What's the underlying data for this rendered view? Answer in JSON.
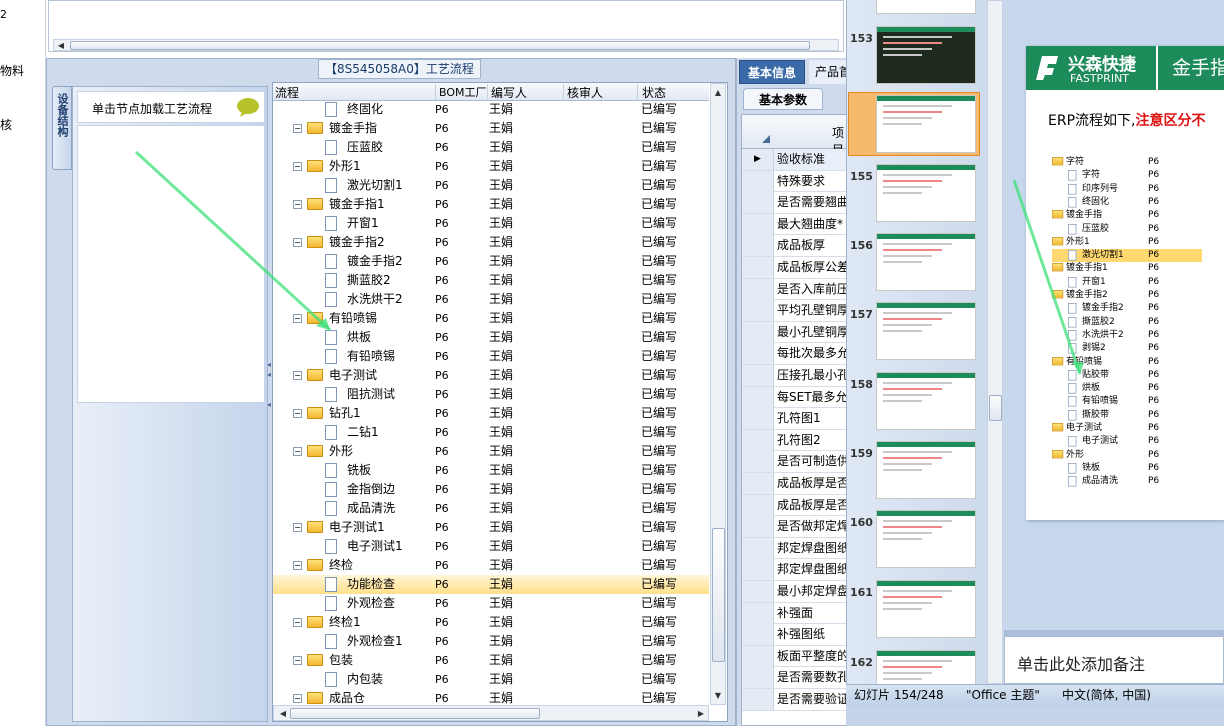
{
  "left_edge": {
    "labels": [
      "2",
      "物料",
      "核"
    ]
  },
  "process_panel": {
    "title": "【8S545058A0】工艺流程",
    "vertical_tab": "设备结构",
    "hint": "单击节点加载工艺流程",
    "columns": [
      "流程",
      "BOM工厂",
      "编写人",
      "核审人",
      "状态"
    ],
    "rows": [
      {
        "label": "终固化",
        "level": 2,
        "folder": false,
        "bom": "P6",
        "writer": "王娟",
        "reviewer": "",
        "status": "已编写"
      },
      {
        "label": "镀金手指",
        "level": 1,
        "folder": true,
        "bom": "P6",
        "writer": "王娟",
        "reviewer": "",
        "status": "已编写"
      },
      {
        "label": "压蓝胶",
        "level": 2,
        "folder": false,
        "bom": "P6",
        "writer": "王娟",
        "reviewer": "",
        "status": "已编写"
      },
      {
        "label": "外形1",
        "level": 1,
        "folder": true,
        "bom": "P6",
        "writer": "王娟",
        "reviewer": "",
        "status": "已编写"
      },
      {
        "label": "激光切割1",
        "level": 2,
        "folder": false,
        "bom": "P6",
        "writer": "王娟",
        "reviewer": "",
        "status": "已编写"
      },
      {
        "label": "镀金手指1",
        "level": 1,
        "folder": true,
        "bom": "P6",
        "writer": "王娟",
        "reviewer": "",
        "status": "已编写"
      },
      {
        "label": "开窗1",
        "level": 2,
        "folder": false,
        "bom": "P6",
        "writer": "王娟",
        "reviewer": "",
        "status": "已编写"
      },
      {
        "label": "镀金手指2",
        "level": 1,
        "folder": true,
        "bom": "P6",
        "writer": "王娟",
        "reviewer": "",
        "status": "已编写"
      },
      {
        "label": "镀金手指2",
        "level": 2,
        "folder": false,
        "bom": "P6",
        "writer": "王娟",
        "reviewer": "",
        "status": "已编写"
      },
      {
        "label": "撕蓝胶2",
        "level": 2,
        "folder": false,
        "bom": "P6",
        "writer": "王娟",
        "reviewer": "",
        "status": "已编写"
      },
      {
        "label": "水洗烘干2",
        "level": 2,
        "folder": false,
        "bom": "P6",
        "writer": "王娟",
        "reviewer": "",
        "status": "已编写"
      },
      {
        "label": "有铅喷锡",
        "level": 1,
        "folder": true,
        "bom": "P6",
        "writer": "王娟",
        "reviewer": "",
        "status": "已编写"
      },
      {
        "label": "烘板",
        "level": 2,
        "folder": false,
        "bom": "P6",
        "writer": "王娟",
        "reviewer": "",
        "status": "已编写"
      },
      {
        "label": "有铅喷锡",
        "level": 2,
        "folder": false,
        "bom": "P6",
        "writer": "王娟",
        "reviewer": "",
        "status": "已编写"
      },
      {
        "label": "电子测试",
        "level": 1,
        "folder": true,
        "bom": "P6",
        "writer": "王娟",
        "reviewer": "",
        "status": "已编写"
      },
      {
        "label": "阻抗测试",
        "level": 2,
        "folder": false,
        "bom": "P6",
        "writer": "王娟",
        "reviewer": "",
        "status": "已编写"
      },
      {
        "label": "钻孔1",
        "level": 1,
        "folder": true,
        "bom": "P6",
        "writer": "王娟",
        "reviewer": "",
        "status": "已编写"
      },
      {
        "label": "二钻1",
        "level": 2,
        "folder": false,
        "bom": "P6",
        "writer": "王娟",
        "reviewer": "",
        "status": "已编写"
      },
      {
        "label": "外形",
        "level": 1,
        "folder": true,
        "bom": "P6",
        "writer": "王娟",
        "reviewer": "",
        "status": "已编写"
      },
      {
        "label": "铣板",
        "level": 2,
        "folder": false,
        "bom": "P6",
        "writer": "王娟",
        "reviewer": "",
        "status": "已编写"
      },
      {
        "label": "金指倒边",
        "level": 2,
        "folder": false,
        "bom": "P6",
        "writer": "王娟",
        "reviewer": "",
        "status": "已编写"
      },
      {
        "label": "成品清洗",
        "level": 2,
        "folder": false,
        "bom": "P6",
        "writer": "王娟",
        "reviewer": "",
        "status": "已编写"
      },
      {
        "label": "电子测试1",
        "level": 1,
        "folder": true,
        "bom": "P6",
        "writer": "王娟",
        "reviewer": "",
        "status": "已编写"
      },
      {
        "label": "电子测试1",
        "level": 2,
        "folder": false,
        "bom": "P6",
        "writer": "王娟",
        "reviewer": "",
        "status": "已编写"
      },
      {
        "label": "终检",
        "level": 1,
        "folder": true,
        "bom": "P6",
        "writer": "王娟",
        "reviewer": "",
        "status": "已编写"
      },
      {
        "label": "功能检查",
        "level": 2,
        "folder": false,
        "bom": "P6",
        "writer": "王娟",
        "reviewer": "",
        "status": "已编写",
        "selected": true
      },
      {
        "label": "外观检查",
        "level": 2,
        "folder": false,
        "bom": "P6",
        "writer": "王娟",
        "reviewer": "",
        "status": "已编写"
      },
      {
        "label": "终检1",
        "level": 1,
        "folder": true,
        "bom": "P6",
        "writer": "王娟",
        "reviewer": "",
        "status": "已编写"
      },
      {
        "label": "外观检查1",
        "level": 2,
        "folder": false,
        "bom": "P6",
        "writer": "王娟",
        "reviewer": "",
        "status": "已编写"
      },
      {
        "label": "包装",
        "level": 1,
        "folder": true,
        "bom": "P6",
        "writer": "王娟",
        "reviewer": "",
        "status": "已编写"
      },
      {
        "label": "内包装",
        "level": 2,
        "folder": false,
        "bom": "P6",
        "writer": "王娟",
        "reviewer": "",
        "status": "已编写"
      },
      {
        "label": "成品仓",
        "level": 1,
        "folder": true,
        "bom": "P6",
        "writer": "王娟",
        "reviewer": "",
        "status": "已编写"
      }
    ]
  },
  "info_panel": {
    "tabs": [
      "基本信息",
      "产品首"
    ],
    "subtab": "基本参数",
    "column_header": "项目",
    "rows": [
      "验收标准",
      "特殊要求",
      "是否需要翘曲",
      "最大翘曲度*",
      "成品板厚",
      "成品板厚公差",
      "是否入库前压",
      "平均孔壁铜厚",
      "最小孔壁铜厚",
      "每批次最多允",
      "压接孔最小孔",
      "每SET最多允许",
      "孔符图1",
      "孔符图2",
      "是否可制造供",
      "成品板厚是否",
      "成品板厚是否",
      "是否做邦定焊",
      "邦定焊盘图纸",
      "邦定焊盘图纸",
      "最小邦定焊盘",
      "补强面",
      "补强图纸",
      "板面平整度的",
      "是否需要数孔",
      "是否需要验证"
    ]
  },
  "ppt": {
    "slide_numbers": [
      "153",
      "154",
      "155",
      "156",
      "157",
      "158",
      "159",
      "160",
      "161",
      "162"
    ],
    "logo_cn": "兴森快捷",
    "logo_en": "FASTPRINT",
    "slide_title": "金手指",
    "body_text_prefix": "ERP流程如下,",
    "body_text_red": "注意区分不",
    "tree_items": [
      {
        "label": "字符",
        "level": 0
      },
      {
        "label": "字符",
        "level": 1
      },
      {
        "label": "印序列号",
        "level": 1
      },
      {
        "label": "终固化",
        "level": 1
      },
      {
        "label": "镀金手指",
        "level": 0
      },
      {
        "label": "压蓝胶",
        "level": 1
      },
      {
        "label": "外形1",
        "level": 0
      },
      {
        "label": "激光切割1",
        "level": 1,
        "hl": true
      },
      {
        "label": "镀金手指1",
        "level": 0
      },
      {
        "label": "开窗1",
        "level": 1
      },
      {
        "label": "镀金手指2",
        "level": 0
      },
      {
        "label": "镀金手指2",
        "level": 1
      },
      {
        "label": "撕蓝胶2",
        "level": 1
      },
      {
        "label": "水洗烘干2",
        "level": 1
      },
      {
        "label": "剥锡2",
        "level": 1
      },
      {
        "label": "有铅喷锡",
        "level": 0
      },
      {
        "label": "贴胶带",
        "level": 1
      },
      {
        "label": "烘板",
        "level": 1
      },
      {
        "label": "有铅喷锡",
        "level": 1
      },
      {
        "label": "撕胶带",
        "level": 1
      },
      {
        "label": "电子测试",
        "level": 0
      },
      {
        "label": "电子测试",
        "level": 1
      },
      {
        "label": "外形",
        "level": 0
      },
      {
        "label": "铣板",
        "level": 1
      },
      {
        "label": "成品清洗",
        "level": 1
      }
    ],
    "tree_value": "P6",
    "notes_placeholder": "单击此处添加备注",
    "status": {
      "slide": "幻灯片 154/248",
      "theme": "\"Office 主题\"",
      "language": "中文(简体, 中国)"
    }
  },
  "colors": {
    "accent": "#1d8b5a",
    "selection": "#ffd970",
    "panel_blue": "#cfdbec",
    "header_blue": "#3b6aa8"
  }
}
